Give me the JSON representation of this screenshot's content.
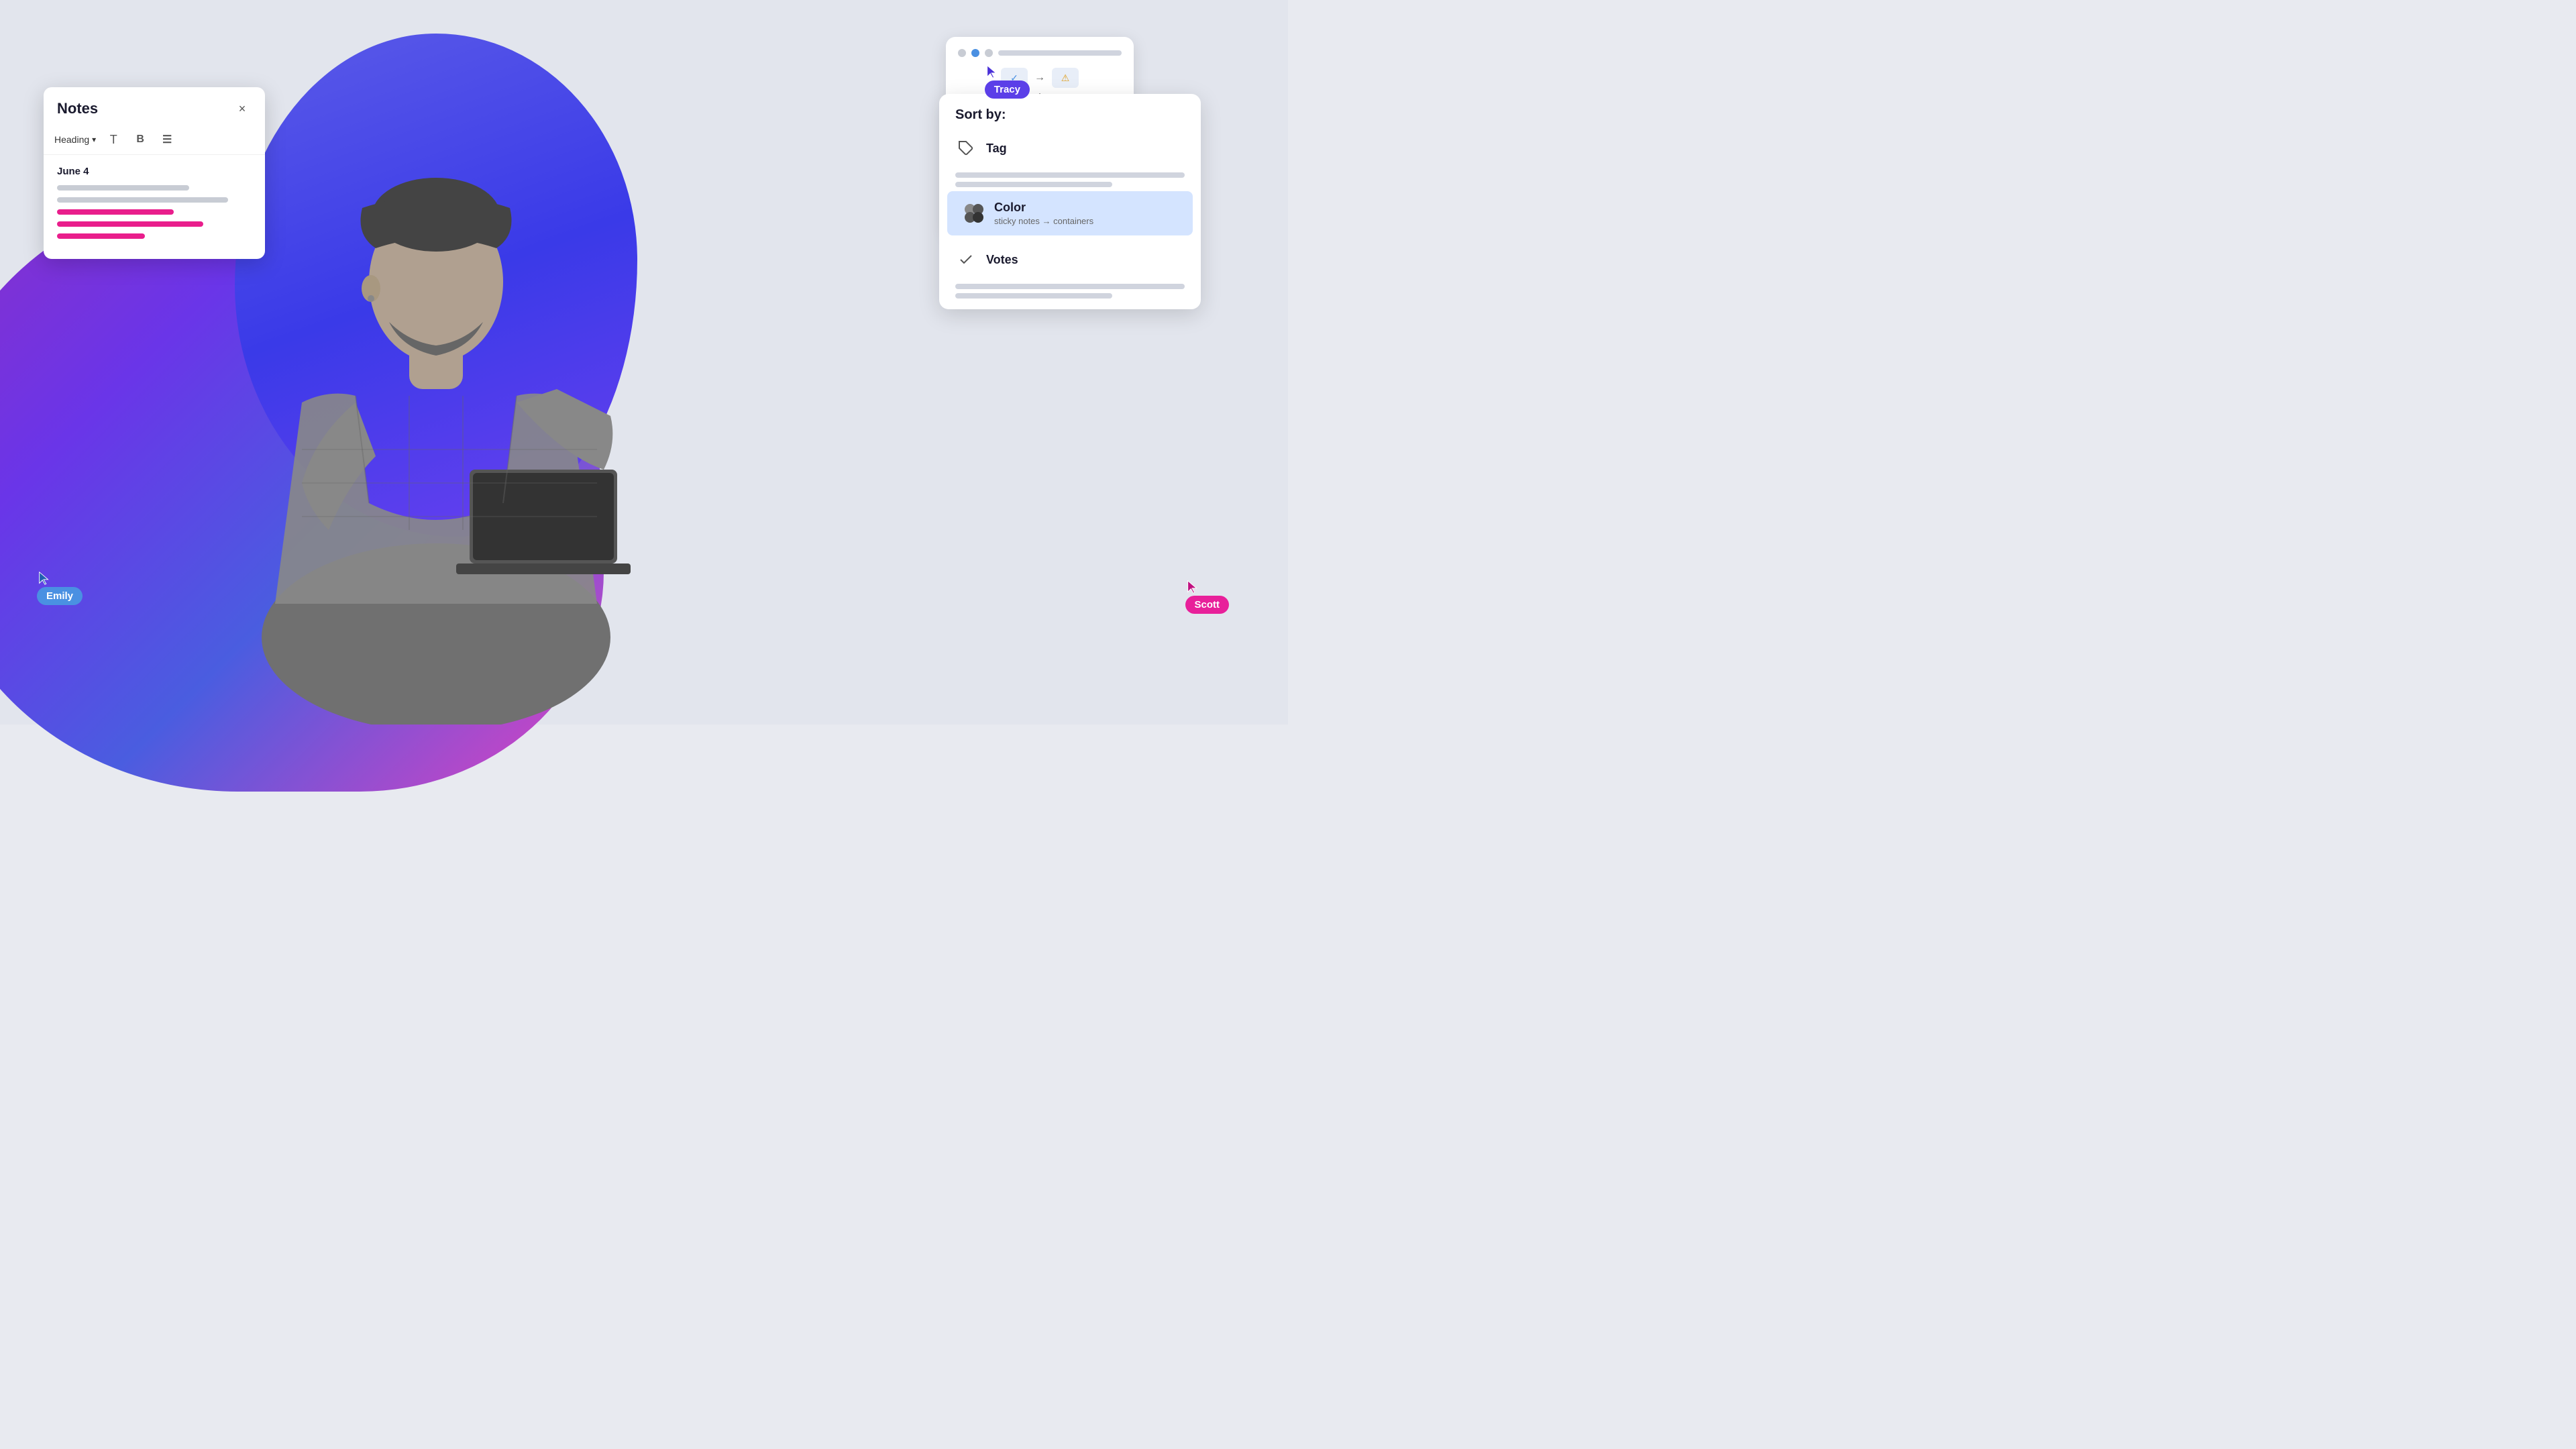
{
  "background": {
    "color": "#e2e5ed"
  },
  "cursors": {
    "tracy": {
      "name": "Tracy",
      "color": "#5b3fe8",
      "position": "top-right"
    },
    "emily": {
      "name": "Emily",
      "color": "#4a90e2",
      "position": "bottom-left"
    },
    "scott": {
      "name": "Scott",
      "color": "#e8209a",
      "position": "bottom-right"
    }
  },
  "notes_panel": {
    "title": "Notes",
    "close_label": "×",
    "toolbar": {
      "heading_label": "Heading",
      "dropdown_arrow": "▾",
      "text_button": "T",
      "bold_button": "B",
      "list_button": "☰"
    },
    "date": "June 4",
    "lines": [
      {
        "width": "68%",
        "color": "gray"
      },
      {
        "width": "88%",
        "color": "gray"
      },
      {
        "width": "60%",
        "color": "pink"
      },
      {
        "width": "75%",
        "color": "pink"
      },
      {
        "width": "45%",
        "color": "pink"
      }
    ]
  },
  "sort_panel": {
    "header": "Sort by:",
    "items": [
      {
        "id": "tag",
        "label": "Tag",
        "icon": "tag",
        "active": false
      },
      {
        "id": "color",
        "label": "Color",
        "subtext": "sticky notes → containers",
        "icon": "color-circles",
        "active": true
      },
      {
        "id": "votes",
        "label": "Votes",
        "icon": "votes",
        "active": false
      }
    ]
  },
  "diagram_panel": {
    "visible": true
  },
  "feature_text": "Color sticky notes containers"
}
